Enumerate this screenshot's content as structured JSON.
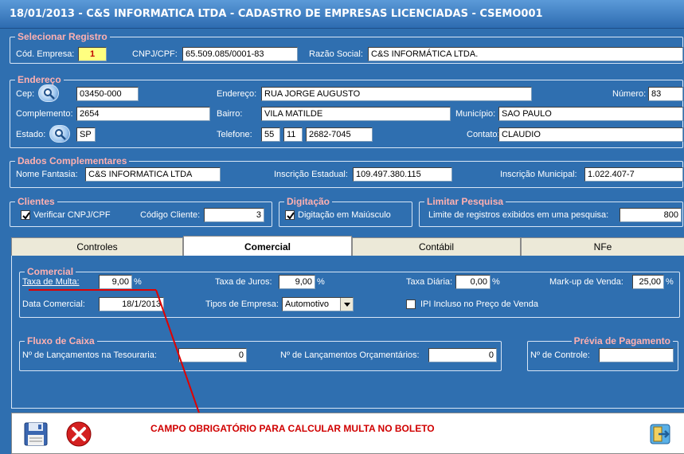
{
  "title": "18/01/2013  -  C&S INFORMATICA LTDA  -  CADASTRO DE EMPRESAS LICENCIADAS  -  CSEMO001",
  "selecionar": {
    "title": "Selecionar Registro",
    "cod_label": "Cód. Empresa:",
    "cod_value": "1",
    "cnpj_label": "CNPJ/CPF:",
    "cnpj_value": "65.509.085/0001-83",
    "razao_label": "Razão Social:",
    "razao_value": "C&S INFORMÁTICA LTDA."
  },
  "endereco": {
    "title": "Endereço",
    "cep_label": "Cep:",
    "cep_value": "03450-000",
    "endereco_label": "Endereço:",
    "endereco_value": "RUA JORGE AUGUSTO",
    "numero_label": "Número:",
    "numero_value": "83",
    "complemento_label": "Complemento:",
    "complemento_value": "2654",
    "bairro_label": "Bairro:",
    "bairro_value": "VILA MATILDE",
    "municipio_label": "Município:",
    "municipio_value": "SAO PAULO",
    "estado_label": "Estado:",
    "estado_value": "SP",
    "telefone_label": "Telefone:",
    "telefone_ddi": "55",
    "telefone_ddd": "11",
    "telefone_num": "2682-7045",
    "contato_label": "Contato:",
    "contato_value": "CLAUDIO"
  },
  "complementares": {
    "title": "Dados Complementares",
    "fantasia_label": "Nome Fantasia:",
    "fantasia_value": "C&S INFORMATICA LTDA",
    "ie_label": "Inscrição Estadual:",
    "ie_value": "109.497.380.115",
    "im_label": "Inscrição Municipal:",
    "im_value": "1.022.407-7"
  },
  "clientes": {
    "title": "Clientes",
    "verificar_label": "Verificar CNPJ/CPF",
    "codigo_label": "Código Cliente:",
    "codigo_value": "3"
  },
  "digitacao": {
    "title": "Digitação",
    "maiusculo_label": "Digitação em Maiúsculo"
  },
  "limitar": {
    "title": "Limitar Pesquisa",
    "limite_label": "Limite de registros exibidos em uma pesquisa:",
    "limite_value": "800"
  },
  "tabs": [
    "Controles",
    "Comercial",
    "Contábil",
    "NFe"
  ],
  "comercial": {
    "title": "Comercial",
    "multa_label": "Taxa de Multa:",
    "multa_value": "9,00",
    "juros_label": "Taxa de Juros:",
    "juros_value": "9,00",
    "diaria_label": "Taxa Diária:",
    "diaria_value": "0,00",
    "markup_label": "Mark-up de Venda:",
    "markup_value": "25,00",
    "pct": "%",
    "data_label": "Data Comercial:",
    "data_value": "18/1/2013",
    "tipos_label": "Tipos de Empresa:",
    "tipos_value": "Automotivo",
    "ipi_label": "IPI Incluso no Preço de Venda"
  },
  "fluxo": {
    "title": "Fluxo de Caixa",
    "tesouraria_label": "Nº de Lançamentos na Tesouraria:",
    "tesouraria_value": "0",
    "orcamentarios_label": "Nº de Lançamentos Orçamentários:",
    "orcamentarios_value": "0"
  },
  "previa": {
    "title": "Prévia de Pagamento",
    "controle_label": "Nº de Controle:",
    "controle_value": ""
  },
  "annotation": "CAMPO OBRIGATÓRIO PARA CALCULAR MULTA NO BOLETO",
  "icons": {
    "save": "floppy-disk-icon",
    "close": "red-x-icon",
    "exit": "exit-door-icon",
    "lookup": "search-lookup-icon"
  },
  "colors": {
    "window_bg": "#2f6fb0",
    "group_title": "#ffb0b0",
    "annotation": "#d00000"
  }
}
